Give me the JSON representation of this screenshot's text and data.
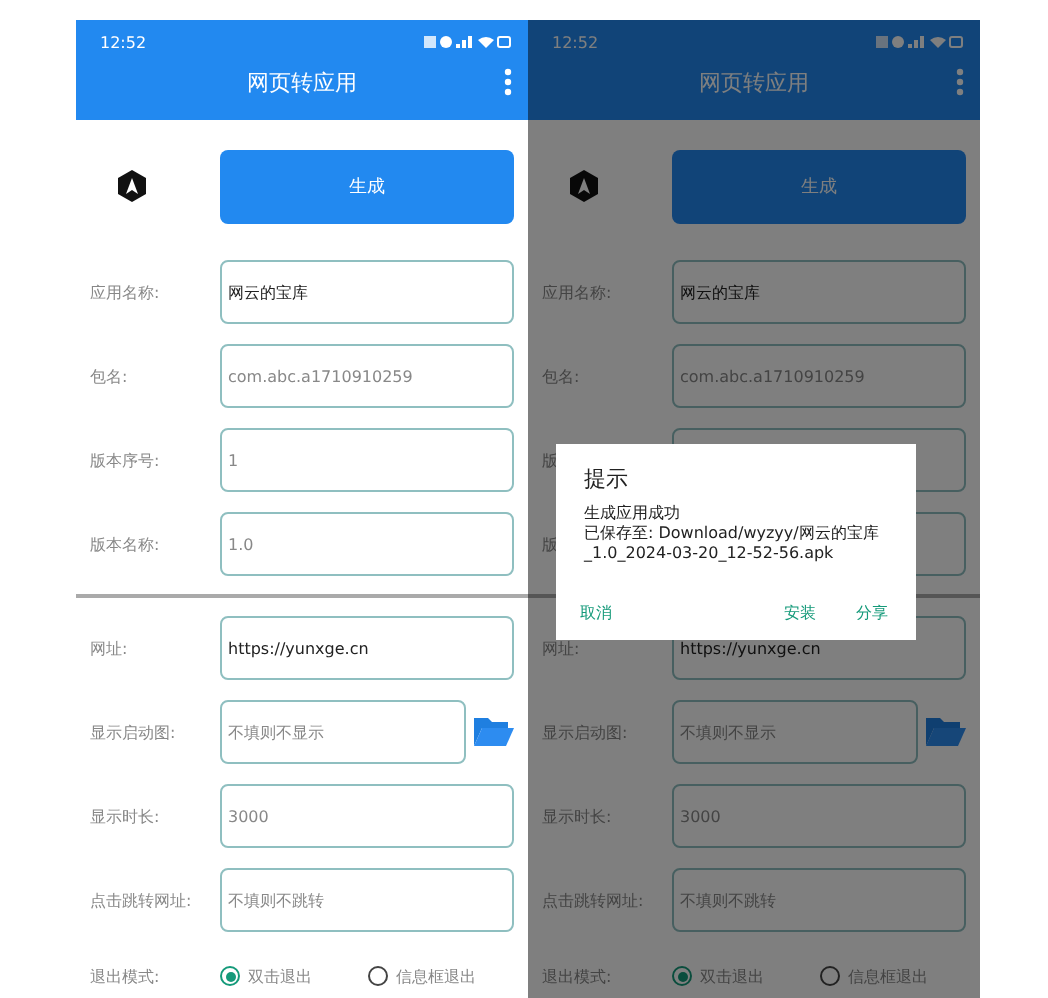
{
  "screens": [
    {
      "status_bar": {
        "time": "12:52"
      },
      "app_bar": {
        "title": "网页转应用"
      },
      "generate_button": "生成",
      "fields": [
        {
          "label": "应用名称:",
          "value": "网云的宝库"
        },
        {
          "label": "包名:",
          "placeholder": "com.abc.a1710910259"
        },
        {
          "label": "版本序号:",
          "placeholder": "1"
        },
        {
          "label": "版本名称:",
          "placeholder": "1.0"
        },
        {
          "label": "网址:",
          "value": "https://yunxge.cn"
        },
        {
          "label": "显示启动图:",
          "placeholder": "不填则不显示",
          "kind": "picker"
        },
        {
          "label": "显示时长:",
          "placeholder": "3000"
        },
        {
          "label": "点击跳转网址:",
          "placeholder": "不填则不跳转"
        }
      ],
      "exit_mode": {
        "label": "退出模式:",
        "options": [
          {
            "label": "双击退出",
            "selected": true
          },
          {
            "label": "信息框退出",
            "selected": false
          }
        ]
      }
    },
    {
      "status_bar": {
        "time": "12:52"
      },
      "app_bar": {
        "title": "网页转应用"
      },
      "generate_button": "生成",
      "fields": [
        {
          "label": "应用名称:",
          "value": "网云的宝库"
        },
        {
          "label": "包名:",
          "placeholder": "com.abc.a1710910259"
        },
        {
          "label": "版"
        },
        {
          "label": "版"
        },
        {
          "label": "网址:",
          "value": "https://yunxge.cn"
        },
        {
          "label": "显示启动图:",
          "placeholder": "不填则不显示",
          "kind": "picker"
        },
        {
          "label": "显示时长:",
          "placeholder": "3000"
        },
        {
          "label": "点击跳转网址:",
          "placeholder": "不填则不跳转"
        }
      ],
      "exit_mode": {
        "label": "退出模式:",
        "options": [
          {
            "label": "双击退出",
            "selected": true
          },
          {
            "label": "信息框退出",
            "selected": false
          }
        ]
      },
      "dialog": {
        "title": "提示",
        "message_lines": [
          "生成应用成功",
          "已保存至: Download/wyzyy/网云的宝库_1.0_2024-03-20_12-52-56.apk"
        ],
        "buttons": [
          "取消",
          "安装",
          "分享"
        ]
      }
    }
  ]
}
